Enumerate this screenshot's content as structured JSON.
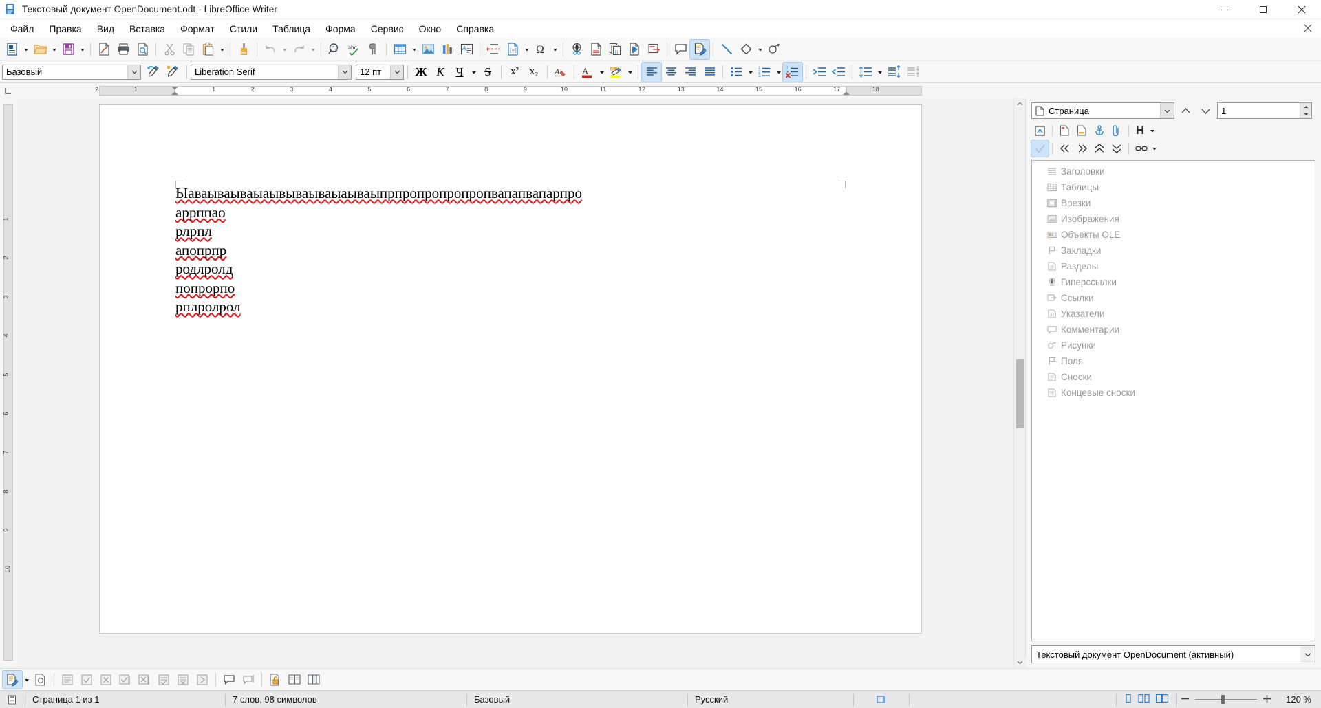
{
  "window": {
    "title": "Текстовый документ OpenDocument.odt - LibreOffice Writer",
    "app_icon": "writer-document-icon",
    "minimize": "minimize-icon",
    "maximize": "maximize-icon",
    "close": "close-icon"
  },
  "menubar": {
    "items": [
      {
        "label": "Файл"
      },
      {
        "label": "Правка"
      },
      {
        "label": "Вид"
      },
      {
        "label": "Вставка"
      },
      {
        "label": "Формат"
      },
      {
        "label": "Стили"
      },
      {
        "label": "Таблица"
      },
      {
        "label": "Форма"
      },
      {
        "label": "Сервис"
      },
      {
        "label": "Окно"
      },
      {
        "label": "Справка"
      }
    ],
    "close_document": "close-document-icon"
  },
  "standard_toolbar": {
    "items": [
      {
        "name": "new-document-icon",
        "kind": "button"
      },
      {
        "name": "new-document-dropdown",
        "kind": "arrow"
      },
      {
        "name": "open-folder-icon",
        "kind": "button"
      },
      {
        "name": "open-dropdown",
        "kind": "arrow"
      },
      {
        "name": "save-icon",
        "kind": "button"
      },
      {
        "name": "save-dropdown",
        "kind": "arrow"
      },
      {
        "name": "separator",
        "kind": "sep"
      },
      {
        "name": "export-pdf-icon",
        "kind": "button"
      },
      {
        "name": "print-icon",
        "kind": "button"
      },
      {
        "name": "print-preview-icon",
        "kind": "button"
      },
      {
        "name": "separator",
        "kind": "sep"
      },
      {
        "name": "cut-icon",
        "kind": "button"
      },
      {
        "name": "copy-icon",
        "kind": "button"
      },
      {
        "name": "paste-icon",
        "kind": "button"
      },
      {
        "name": "paste-dropdown",
        "kind": "arrow"
      },
      {
        "name": "separator",
        "kind": "sep"
      },
      {
        "name": "clone-formatting-icon",
        "kind": "button"
      },
      {
        "name": "separator",
        "kind": "sep"
      },
      {
        "name": "undo-icon",
        "kind": "button"
      },
      {
        "name": "undo-dropdown",
        "kind": "arrow"
      },
      {
        "name": "redo-icon",
        "kind": "button"
      },
      {
        "name": "redo-dropdown",
        "kind": "arrow"
      },
      {
        "name": "separator",
        "kind": "sep"
      },
      {
        "name": "find-replace-icon",
        "kind": "button"
      },
      {
        "name": "spelling-icon",
        "kind": "button"
      },
      {
        "name": "formatting-marks-icon",
        "kind": "button"
      },
      {
        "name": "separator",
        "kind": "sep"
      },
      {
        "name": "insert-table-icon",
        "kind": "button"
      },
      {
        "name": "insert-table-dropdown",
        "kind": "arrow"
      },
      {
        "name": "insert-image-icon",
        "kind": "button"
      },
      {
        "name": "insert-chart-icon",
        "kind": "button"
      },
      {
        "name": "insert-textbox-icon",
        "kind": "button"
      },
      {
        "name": "separator",
        "kind": "sep"
      },
      {
        "name": "page-break-icon",
        "kind": "button"
      },
      {
        "name": "insert-field-icon",
        "kind": "button"
      },
      {
        "name": "insert-field-dropdown",
        "kind": "arrow"
      },
      {
        "name": "special-character-icon",
        "kind": "button"
      },
      {
        "name": "special-character-dropdown",
        "kind": "arrow"
      },
      {
        "name": "separator",
        "kind": "sep"
      },
      {
        "name": "insert-hyperlink-icon",
        "kind": "button"
      },
      {
        "name": "insert-footnote-icon",
        "kind": "button"
      },
      {
        "name": "insert-endnote-icon",
        "kind": "button"
      },
      {
        "name": "insert-bookmark-icon",
        "kind": "button"
      },
      {
        "name": "insert-cross-reference-icon",
        "kind": "button"
      },
      {
        "name": "separator",
        "kind": "sep"
      },
      {
        "name": "insert-comment-icon",
        "kind": "button"
      },
      {
        "name": "track-changes-icon",
        "kind": "button",
        "active": true
      },
      {
        "name": "separator",
        "kind": "sep"
      },
      {
        "name": "insert-line-icon",
        "kind": "button"
      },
      {
        "name": "basic-shapes-icon",
        "kind": "button"
      },
      {
        "name": "basic-shapes-dropdown",
        "kind": "arrow"
      },
      {
        "name": "show-draw-functions-icon",
        "kind": "button"
      }
    ]
  },
  "format_toolbar": {
    "paragraph_style": {
      "value": "Базовый",
      "icon": "chevron-down-icon"
    },
    "update_style_icon": "update-selected-style-icon",
    "new_style_icon": "new-style-from-selection-icon",
    "font_name": {
      "value": "Liberation Serif",
      "icon": "chevron-down-icon"
    },
    "font_size": {
      "value": "12 пт",
      "icon": "chevron-down-icon"
    },
    "bold_label": "Ж",
    "italic_label": "К",
    "underline_label": "Ч",
    "strikethrough_label": "S",
    "superscript_label": "x²",
    "subscript_label": "x₂",
    "items": [
      {
        "name": "bold-button"
      },
      {
        "name": "italic-button"
      },
      {
        "name": "underline-button"
      },
      {
        "name": "underline-dropdown"
      },
      {
        "name": "strikethrough-button"
      },
      {
        "name": "superscript-button"
      },
      {
        "name": "subscript-button"
      },
      {
        "name": "clear-formatting-button"
      },
      {
        "name": "font-color-button"
      },
      {
        "name": "font-color-dropdown"
      },
      {
        "name": "highlight-color-button"
      },
      {
        "name": "highlight-color-dropdown"
      },
      {
        "name": "align-left-button",
        "active": true
      },
      {
        "name": "align-center-button"
      },
      {
        "name": "align-right-button"
      },
      {
        "name": "align-justified-button"
      },
      {
        "name": "unordered-list-button"
      },
      {
        "name": "unordered-list-dropdown"
      },
      {
        "name": "ordered-list-button"
      },
      {
        "name": "ordered-list-dropdown"
      },
      {
        "name": "no-list-button",
        "active": true
      },
      {
        "name": "increase-indent-button"
      },
      {
        "name": "decrease-indent-button"
      },
      {
        "name": "line-spacing-button"
      },
      {
        "name": "line-spacing-dropdown"
      },
      {
        "name": "paragraph-spacing-button"
      },
      {
        "name": "decrease-paragraph-spacing-button"
      }
    ]
  },
  "ruler": {
    "corner_icon": "ruler-tab-icon",
    "h_numbers": [
      "1",
      "2",
      "3",
      "4",
      "5",
      "6",
      "7",
      "8",
      "9",
      "10",
      "11",
      "12",
      "13",
      "14",
      "15",
      "16",
      "17",
      "18"
    ],
    "v_numbers": [
      "1",
      "2",
      "3",
      "4",
      "5",
      "6",
      "7",
      "8",
      "9",
      "10"
    ]
  },
  "document": {
    "paragraphs": [
      "Ыаваываываыаывываываыаываыпрпропропропропвапапвапарпро",
      "аррппао",
      "рлрпл",
      "апопрпр",
      "родлролд",
      "попрорпо",
      "рплролрол"
    ]
  },
  "navigator": {
    "page_selector": {
      "value": "Страница",
      "icon": "page-icon",
      "dropdown_icon": "chevron-down-icon"
    },
    "prev_icon": "triangle-up-icon",
    "next_icon": "triangle-down-icon",
    "page_number": "1",
    "spin_up_icon": "spinner-up-icon",
    "spin_down_icon": "spinner-down-icon",
    "toolbar_row1": [
      {
        "name": "toggle-master-view-icon"
      },
      {
        "name": "navigate-by-page-icon"
      },
      {
        "name": "set-reminder-icon"
      },
      {
        "name": "anchor-icon"
      },
      {
        "name": "drag-mode-icon"
      },
      {
        "name": "heading-levels-icon",
        "label": "H"
      },
      {
        "name": "heading-levels-dropdown"
      }
    ],
    "toolbar_row2": [
      {
        "name": "content-navigation-view-icon",
        "active": true
      },
      {
        "name": "promote-chapter-icon"
      },
      {
        "name": "demote-chapter-icon"
      },
      {
        "name": "promote-level-icon"
      },
      {
        "name": "demote-level-icon"
      },
      {
        "name": "chapter-link-icon"
      },
      {
        "name": "chapter-link-dropdown"
      }
    ],
    "categories": [
      {
        "label": "Заголовки",
        "icon": "headings-icon"
      },
      {
        "label": "Таблицы",
        "icon": "tables-icon"
      },
      {
        "label": "Врезки",
        "icon": "frames-icon"
      },
      {
        "label": "Изображения",
        "icon": "images-icon"
      },
      {
        "label": "Объекты OLE",
        "icon": "ole-objects-icon"
      },
      {
        "label": "Закладки",
        "icon": "bookmarks-icon"
      },
      {
        "label": "Разделы",
        "icon": "sections-icon"
      },
      {
        "label": "Гиперссылки",
        "icon": "hyperlinks-icon"
      },
      {
        "label": "Ссылки",
        "icon": "references-icon"
      },
      {
        "label": "Указатели",
        "icon": "indexes-icon"
      },
      {
        "label": "Комментарии",
        "icon": "comments-icon"
      },
      {
        "label": "Рисунки",
        "icon": "drawings-icon"
      },
      {
        "label": "Поля",
        "icon": "fields-icon"
      },
      {
        "label": "Сноски",
        "icon": "footnotes-icon"
      },
      {
        "label": "Концевые сноски",
        "icon": "endnotes-icon"
      }
    ],
    "document_selector": {
      "value": "Текстовый документ OpenDocument (активный)",
      "dropdown_icon": "chevron-down-icon"
    }
  },
  "track_changes_bar": {
    "items": [
      {
        "name": "track-changes-record-icon",
        "active": true
      },
      {
        "name": "track-changes-record-dropdown"
      },
      {
        "name": "show-changes-icon"
      },
      {
        "name": "separator"
      },
      {
        "name": "manage-changes-icon"
      },
      {
        "name": "accept-change-icon"
      },
      {
        "name": "reject-change-icon"
      },
      {
        "name": "accept-all-icon"
      },
      {
        "name": "reject-all-icon"
      },
      {
        "name": "accept-track-change-icon"
      },
      {
        "name": "reject-track-change-icon"
      },
      {
        "name": "next-change-icon"
      },
      {
        "name": "previous-change-icon"
      },
      {
        "name": "separator"
      },
      {
        "name": "insert-comment-icon"
      },
      {
        "name": "manage-comments-icon"
      },
      {
        "name": "separator"
      },
      {
        "name": "protect-changes-icon"
      },
      {
        "name": "compare-document-icon"
      },
      {
        "name": "merge-document-icon"
      }
    ]
  },
  "statusbar": {
    "save_icon": "document-modified-icon",
    "page_info": "Страница 1 из 1",
    "word_count": "7 слов, 98 символов",
    "page_style": "Базовый",
    "language": "Русский",
    "selection_mode_icon": "selection-mode-icon",
    "digital_signature": "",
    "view_layouts": [
      {
        "name": "single-page-view-icon"
      },
      {
        "name": "multi-page-view-icon"
      },
      {
        "name": "book-view-icon"
      }
    ],
    "zoom_out_icon": "zoom-out-icon",
    "zoom_in_icon": "zoom-in-icon",
    "zoom_level": "120 %"
  },
  "colors": {
    "accent": "#2a6099",
    "selected": "#cfe3f7",
    "spell_error": "#e01b1b",
    "statusbar_bg": "#e8e8e8",
    "toolbar_bg": "#f8f8f8"
  }
}
